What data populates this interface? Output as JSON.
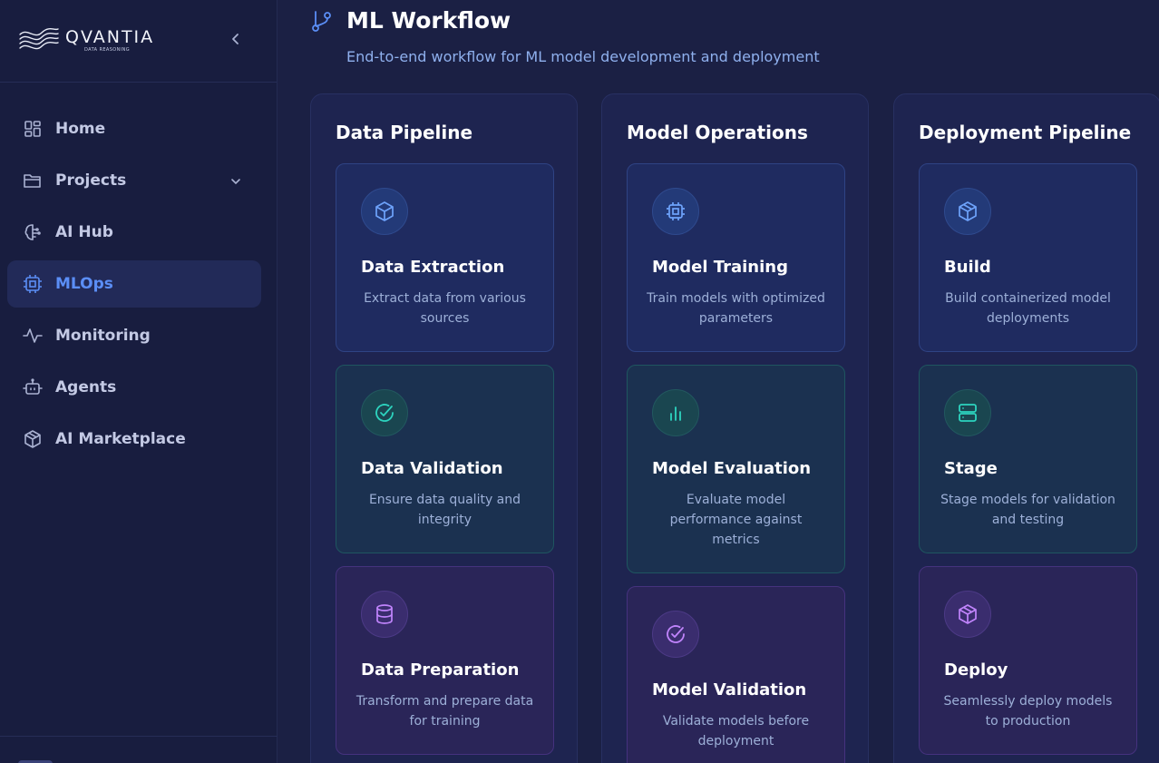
{
  "brand": {
    "name": "QVANTIA",
    "tagline": "DATA REASONING"
  },
  "sidebar": {
    "items": [
      {
        "label": "Home",
        "icon": "grid-icon"
      },
      {
        "label": "Projects",
        "icon": "folder-icon",
        "has_submenu": true
      },
      {
        "label": "AI Hub",
        "icon": "brain-icon"
      },
      {
        "label": "MLOps",
        "icon": "cpu-icon",
        "active": true
      },
      {
        "label": "Monitoring",
        "icon": "activity-icon"
      },
      {
        "label": "Agents",
        "icon": "bot-icon"
      },
      {
        "label": "AI Marketplace",
        "icon": "package-icon"
      }
    ]
  },
  "header": {
    "title": "ML Workflow",
    "subtitle": "End-to-end workflow for ML model development and deployment",
    "icon": "git-branch-icon"
  },
  "columns": [
    {
      "title": "Data Pipeline",
      "cards": [
        {
          "title": "Data Extraction",
          "description": "Extract data from various sources",
          "icon": "box-icon",
          "variant": "blue"
        },
        {
          "title": "Data Validation",
          "description": "Ensure data quality and integrity",
          "icon": "check-circle-icon",
          "variant": "teal"
        },
        {
          "title": "Data Preparation",
          "description": "Transform and prepare data for training",
          "icon": "database-icon",
          "variant": "purple"
        }
      ]
    },
    {
      "title": "Model Operations",
      "cards": [
        {
          "title": "Model Training",
          "description": "Train models with optimized parameters",
          "icon": "cpu-icon",
          "variant": "blue"
        },
        {
          "title": "Model Evaluation",
          "description": "Evaluate model performance against metrics",
          "icon": "bar-chart-icon",
          "variant": "teal"
        },
        {
          "title": "Model Validation",
          "description": "Validate models before deployment",
          "icon": "check-circle-icon",
          "variant": "purple"
        }
      ]
    },
    {
      "title": "Deployment Pipeline",
      "cards": [
        {
          "title": "Build",
          "description": "Build containerized model deployments",
          "icon": "box-icon",
          "variant": "blue"
        },
        {
          "title": "Stage",
          "description": "Stage models for validation and testing",
          "icon": "server-icon",
          "variant": "teal"
        },
        {
          "title": "Deploy",
          "description": "Seamlessly deploy models to production",
          "icon": "box-icon",
          "variant": "purple"
        }
      ]
    }
  ],
  "colors": {
    "accent_blue": "#5b8ef6",
    "accent_teal": "#2dd4bf",
    "accent_purple": "#c084fc",
    "background": "#1b2044",
    "sidebar_bg": "#181d3f"
  }
}
